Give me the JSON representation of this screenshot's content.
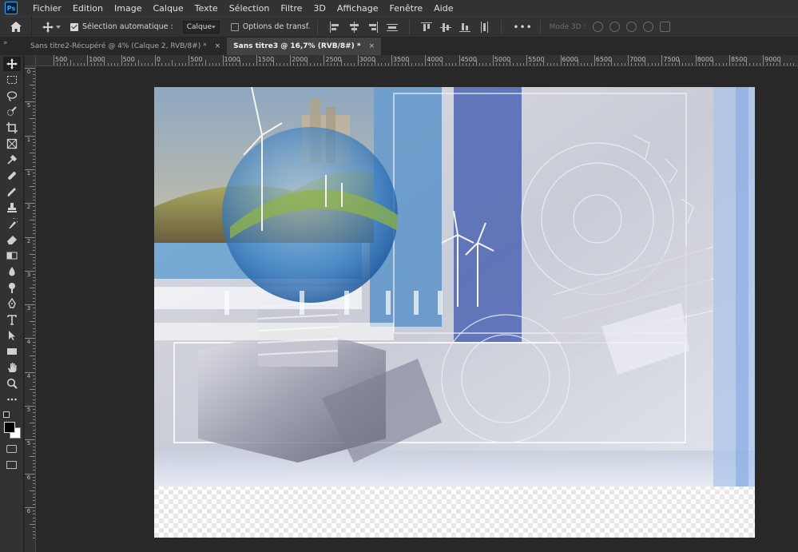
{
  "app": {
    "logo_text": "Ps",
    "brand_color": "#31a8ff"
  },
  "menu": [
    "Fichier",
    "Edition",
    "Image",
    "Calque",
    "Texte",
    "Sélection",
    "Filtre",
    "3D",
    "Affichage",
    "Fenêtre",
    "Aide"
  ],
  "options_bar": {
    "auto_select_label": "Sélection automatique :",
    "auto_select_checked": true,
    "auto_select_target": "Calque",
    "transform_options_label": "Options de transf.",
    "transform_options_checked": false,
    "more_label": "•••",
    "mode3d_label": "Mode 3D :"
  },
  "tabs": [
    {
      "label": "Sans titre2-Récupéré @ 4% (Calque 2, RVB/8#) *",
      "active": false,
      "close": "×"
    },
    {
      "label": "Sans titre3 @ 16,7% (RVB/8#) *",
      "active": true,
      "close": "×"
    }
  ],
  "ruler_top_labels": [
    "500",
    "1000",
    "500",
    "0",
    "500",
    "1000",
    "1500",
    "2000",
    "2500",
    "3000",
    "3500",
    "4000",
    "4500",
    "5000",
    "5500",
    "6000",
    "6500",
    "7000",
    "7500",
    "8000",
    "8500",
    "9000"
  ],
  "ruler_left_labels": [
    "0",
    "5",
    "1",
    "1",
    "2",
    "2",
    "3",
    "3",
    "4",
    "4",
    "5",
    "5",
    "6",
    "6"
  ],
  "tools": [
    {
      "name": "move-tool-icon",
      "active": true
    },
    {
      "name": "marquee-tool-icon"
    },
    {
      "name": "lasso-tool-icon"
    },
    {
      "name": "quick-select-tool-icon"
    },
    {
      "name": "crop-tool-icon"
    },
    {
      "name": "frame-tool-icon"
    },
    {
      "name": "eyedropper-tool-icon"
    },
    {
      "name": "healing-brush-tool-icon"
    },
    {
      "name": "brush-tool-icon"
    },
    {
      "name": "clone-stamp-tool-icon"
    },
    {
      "name": "history-brush-tool-icon"
    },
    {
      "name": "eraser-tool-icon"
    },
    {
      "name": "gradient-tool-icon"
    },
    {
      "name": "blur-tool-icon"
    },
    {
      "name": "dodge-tool-icon"
    },
    {
      "name": "pen-tool-icon"
    },
    {
      "name": "type-tool-icon"
    },
    {
      "name": "path-select-tool-icon"
    },
    {
      "name": "rectangle-tool-icon"
    },
    {
      "name": "hand-tool-icon"
    },
    {
      "name": "zoom-tool-icon"
    },
    {
      "name": "edit-toolbar-icon"
    }
  ],
  "colors": {
    "foreground": "#000000",
    "background": "#ffffff",
    "accent": "#31a8ff"
  }
}
